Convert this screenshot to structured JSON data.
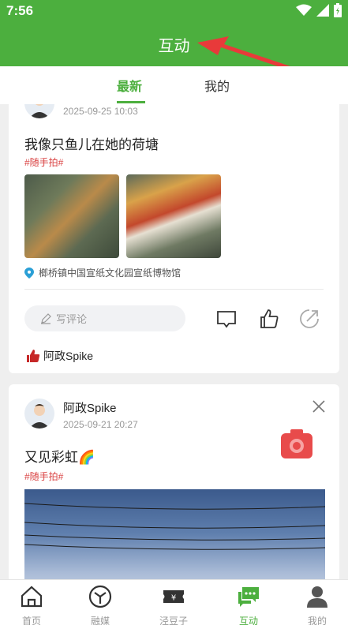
{
  "status_bar": {
    "time": "7:56"
  },
  "header": {
    "title": "互动"
  },
  "tabs": [
    {
      "label": "最新"
    },
    {
      "label": "我的"
    }
  ],
  "posts": [
    {
      "date": "2025-09-25 10:03",
      "text": "我像只鱼儿在她的荷塘",
      "tag": "#随手拍#",
      "location": "榔桥镇中国宣纸文化园宣纸博物馆",
      "comment_placeholder": "写评论",
      "liked_by": "阿政Spike"
    },
    {
      "author": "阿政Spike",
      "date": "2025-09-21 20:27",
      "text": "又见彩虹🌈",
      "tag": "#随手拍#"
    }
  ],
  "bottom_nav": [
    {
      "label": "首页",
      "icon": "home-icon"
    },
    {
      "label": "融媒",
      "icon": "cube-icon"
    },
    {
      "label": "泾豆子",
      "icon": "ticket-icon"
    },
    {
      "label": "互动",
      "icon": "chat-icon",
      "active": true
    },
    {
      "label": "我的",
      "icon": "person-icon"
    }
  ],
  "colors": {
    "brand": "#4caf3e",
    "tag": "#d94040",
    "camera": "#e84b4b"
  }
}
